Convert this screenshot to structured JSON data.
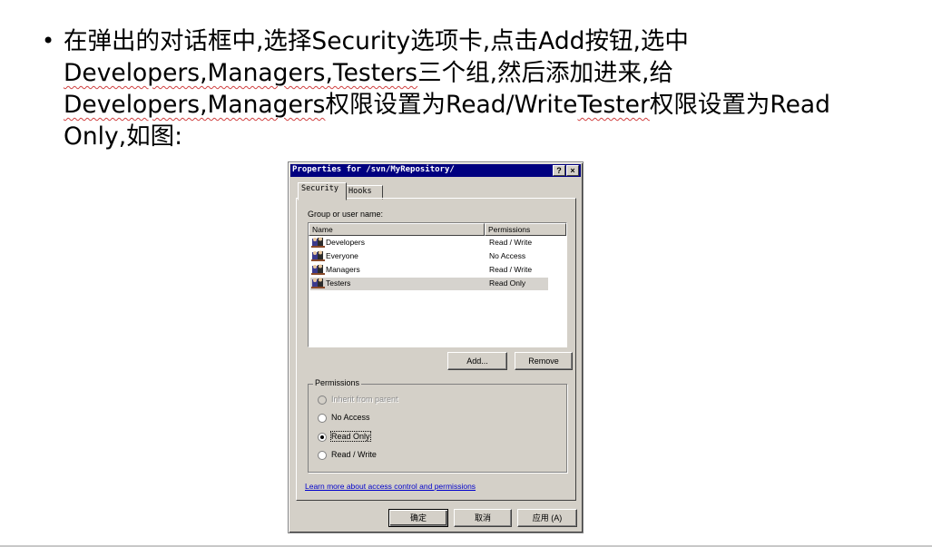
{
  "slide": {
    "bullet": "•",
    "line1": "在弹出的对话框中,选择Security选项卡,点击Add按钮,选中",
    "line2_names": "Developers,Managers,Testers",
    "line2_rest": "三个组,然后添加进来,给",
    "line3_names": "Developers,Managers",
    "line3_mid1": "权限设置为",
    "line3_rw": "Read/Write",
    "line3_tester": "Tester",
    "line3_mid2": "权限设置为",
    "line3_read": "Read",
    "line4": "Only,如图:"
  },
  "dialog": {
    "title": "Properties for /svn/MyRepository/",
    "help_button": "?",
    "close_button": "×",
    "tabs": [
      "Security",
      "Hooks"
    ],
    "group_label": "Group or user name:",
    "columns": [
      "Name",
      "Permissions"
    ],
    "rows": [
      {
        "name": "Developers",
        "permission": "Read / Write",
        "selected": false
      },
      {
        "name": "Everyone",
        "permission": "No Access",
        "selected": false
      },
      {
        "name": "Managers",
        "permission": "Read / Write",
        "selected": false
      },
      {
        "name": "Testers",
        "permission": "Read Only",
        "selected": true
      }
    ],
    "add_button": "Add...",
    "remove_button": "Remove",
    "permissions_title": "Permissions",
    "radio_options": [
      {
        "label": "Inherit from parent",
        "checked": false,
        "enabled": false
      },
      {
        "label": "No Access",
        "checked": false,
        "enabled": true
      },
      {
        "label": "Read Only",
        "checked": true,
        "enabled": true
      },
      {
        "label": "Read / Write",
        "checked": false,
        "enabled": true
      }
    ],
    "help_link": "Learn more about access control and permissions",
    "ok_button": "确定",
    "cancel_button": "取消",
    "apply_button": "应用 (A)"
  }
}
